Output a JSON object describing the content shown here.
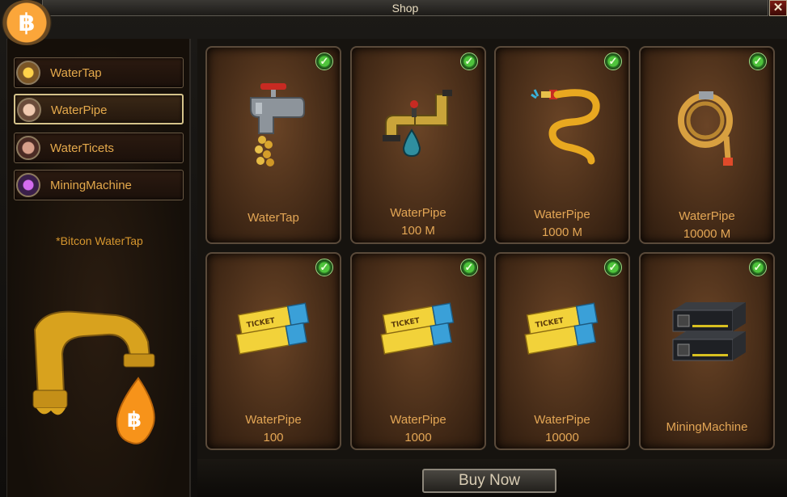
{
  "window": {
    "title": "Shop",
    "close_label": "✕",
    "logo_symbol": "฿"
  },
  "sidebar": {
    "items": [
      {
        "label": "WaterTap",
        "icon": "star-coin-icon",
        "active": false
      },
      {
        "label": "WaterPipe",
        "icon": "pipe-avatar-icon",
        "active": true
      },
      {
        "label": "WaterTicets",
        "icon": "ticket-avatar-icon",
        "active": false
      },
      {
        "label": "MiningMachine",
        "icon": "machine-orb-icon",
        "active": false
      }
    ],
    "caption": "*Bitcon WaterTap",
    "illustration": "golden-pipe-bitcoin-drop-icon"
  },
  "cards": [
    {
      "line1": "WaterTap",
      "line2": "",
      "icon": "faucet-coins-icon",
      "checked": true
    },
    {
      "line1": "WaterPipe",
      "line2": "100 M",
      "icon": "pipe-valve-drop-icon",
      "checked": true
    },
    {
      "line1": "WaterPipe",
      "line2": "1000 M",
      "icon": "hose-icon",
      "checked": true
    },
    {
      "line1": "WaterPipe",
      "line2": "10000 M",
      "icon": "coiled-hose-icon",
      "checked": true
    },
    {
      "line1": "WaterPipe",
      "line2": "100",
      "icon": "ticket-icon",
      "checked": true
    },
    {
      "line1": "WaterPipe",
      "line2": "1000",
      "icon": "ticket-icon",
      "checked": true
    },
    {
      "line1": "WaterPipe",
      "line2": "10000",
      "icon": "ticket-icon",
      "checked": true
    },
    {
      "line1": "MiningMachine",
      "line2": "",
      "icon": "mining-rig-icon",
      "checked": true
    }
  ],
  "ticket_text": "TICKET",
  "check_symbol": "✓",
  "buy_button": "Buy Now",
  "colors": {
    "accent_text": "#e3a655",
    "check_green": "#4fc43c",
    "bitcoin_orange": "#f7931a"
  }
}
